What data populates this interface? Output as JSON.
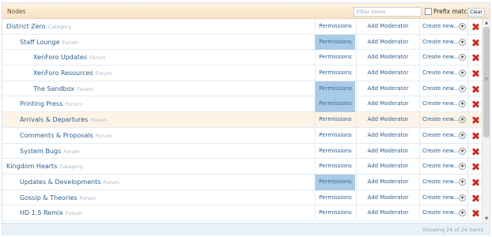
{
  "header": {
    "title": "Nodes",
    "filter_placeholder": "Filter items",
    "prefix_match_label": "Prefix match",
    "clear_label": "Clear"
  },
  "actions": {
    "permissions": "Permissions",
    "add_moderator": "Add Moderator",
    "create_new": "Create new..."
  },
  "rows": [
    {
      "name": "District Zero",
      "type": "Category",
      "level": 0,
      "perm_active": false,
      "highlight": false
    },
    {
      "name": "Staff Lounge",
      "type": "Forum",
      "level": 1,
      "perm_active": true,
      "highlight": false
    },
    {
      "name": "XenForo Updates",
      "type": "Forum",
      "level": 2,
      "perm_active": false,
      "highlight": false
    },
    {
      "name": "XenForo Resources",
      "type": "Forum",
      "level": 2,
      "perm_active": false,
      "highlight": false
    },
    {
      "name": "The Sandbox",
      "type": "Forum",
      "level": 2,
      "perm_active": true,
      "highlight": false
    },
    {
      "name": "Printing Press",
      "type": "Forum",
      "level": 1,
      "perm_active": true,
      "highlight": false
    },
    {
      "name": "Arrivals & Departures",
      "type": "Forum",
      "level": 1,
      "perm_active": false,
      "highlight": true
    },
    {
      "name": "Comments & Proposals",
      "type": "Forum",
      "level": 1,
      "perm_active": false,
      "highlight": false
    },
    {
      "name": "System Bugs",
      "type": "Forum",
      "level": 1,
      "perm_active": false,
      "highlight": false
    },
    {
      "name": "Kingdom Hearts",
      "type": "Category",
      "level": 0,
      "perm_active": false,
      "highlight": false
    },
    {
      "name": "Updates & Developments",
      "type": "Forum",
      "level": 1,
      "perm_active": true,
      "highlight": false
    },
    {
      "name": "Gossip & Theories",
      "type": "Forum",
      "level": 1,
      "perm_active": false,
      "highlight": false
    },
    {
      "name": "HD 1.5 Remix",
      "type": "Forum",
      "level": 1,
      "perm_active": false,
      "highlight": false
    }
  ],
  "footer": {
    "count_text": "Showing 24 of 24 items"
  },
  "colors": {
    "header_bg": "#f6e3c6",
    "link": "#2d5f8f",
    "perm_active_bg": "#a9cbe7",
    "delete": "#d0281f",
    "row_highlight": "#fdf3e6"
  }
}
